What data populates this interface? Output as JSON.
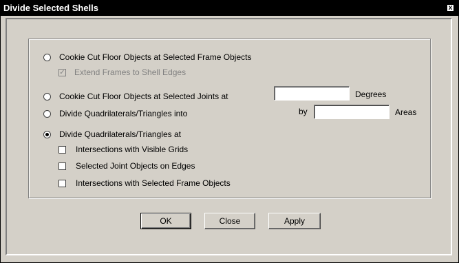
{
  "window": {
    "title": "Divide Selected Shells",
    "close_glyph": "x"
  },
  "options": {
    "cookie_cut_frames": {
      "label": "Cookie Cut Floor Objects at Selected Frame Objects",
      "selected": false,
      "extend_frames": {
        "label": "Extend Frames to Shell Edges",
        "checked": true,
        "enabled": false
      }
    },
    "cookie_cut_joints": {
      "label": "Cookie Cut Floor Objects at Selected Joints at",
      "selected": false,
      "degrees_value": "",
      "degrees_unit": "Degrees"
    },
    "divide_into": {
      "label": "Divide Quadrilaterals/Triangles into",
      "selected": false,
      "by_label": "by",
      "areas_value": "",
      "areas_unit": "Areas"
    },
    "divide_at": {
      "label": "Divide Quadrilaterals/Triangles at",
      "selected": true,
      "sub_options": [
        {
          "label": "Intersections with Visible Grids",
          "checked": false
        },
        {
          "label": "Selected Joint Objects on Edges",
          "checked": false
        },
        {
          "label": "Intersections with Selected Frame Objects",
          "checked": false
        }
      ]
    }
  },
  "buttons": {
    "ok": "OK",
    "close": "Close",
    "apply": "Apply"
  },
  "colors": {
    "titlebar": "#000000",
    "face": "#d4d0c8",
    "shadow": "#808080",
    "highlight": "#ffffff"
  }
}
